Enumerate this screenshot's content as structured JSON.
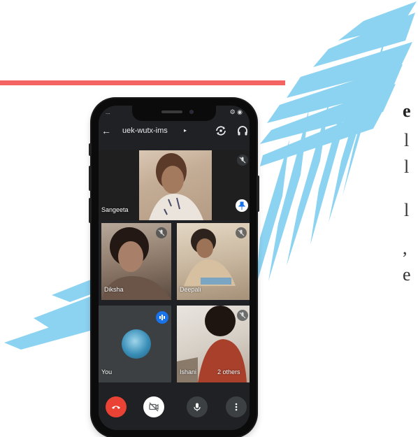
{
  "page": {
    "side_text": [
      "e",
      "l",
      "l",
      "l",
      ",",
      "e"
    ],
    "accent_color": "#f46462",
    "leaf_color": "#8cd3f2"
  },
  "status_bar": {
    "left": "...",
    "right": "⚙ ◉"
  },
  "meeting": {
    "code": "uek-wutx-ims",
    "code_arrow": "▸",
    "back_icon": "←",
    "icons": [
      "arrow-back-icon",
      "camera-flip-icon",
      "headphones-icon"
    ]
  },
  "tiles": [
    {
      "name": "Sangeeta",
      "badge": "mic-off-icon",
      "pin": "push-pin-icon"
    },
    {
      "name": "Diksha",
      "badge": "mic-off-icon"
    },
    {
      "name": "Deepali",
      "badge": "mic-off-icon"
    },
    {
      "name": "You",
      "badge": "speaking-icon"
    },
    {
      "name": "Ishani",
      "extra": "2 others",
      "badge": "mic-off-icon"
    }
  ],
  "controls": [
    {
      "name": "end-call",
      "icon": "phone-hangup-icon",
      "color": "#ea4335"
    },
    {
      "name": "camera-off",
      "icon": "video-off-icon",
      "color": "#ffffff"
    },
    {
      "name": "microphone",
      "icon": "mic-icon",
      "color": "#3c4043"
    },
    {
      "name": "more",
      "icon": "more-vert-icon",
      "color": "#3c4043"
    }
  ]
}
